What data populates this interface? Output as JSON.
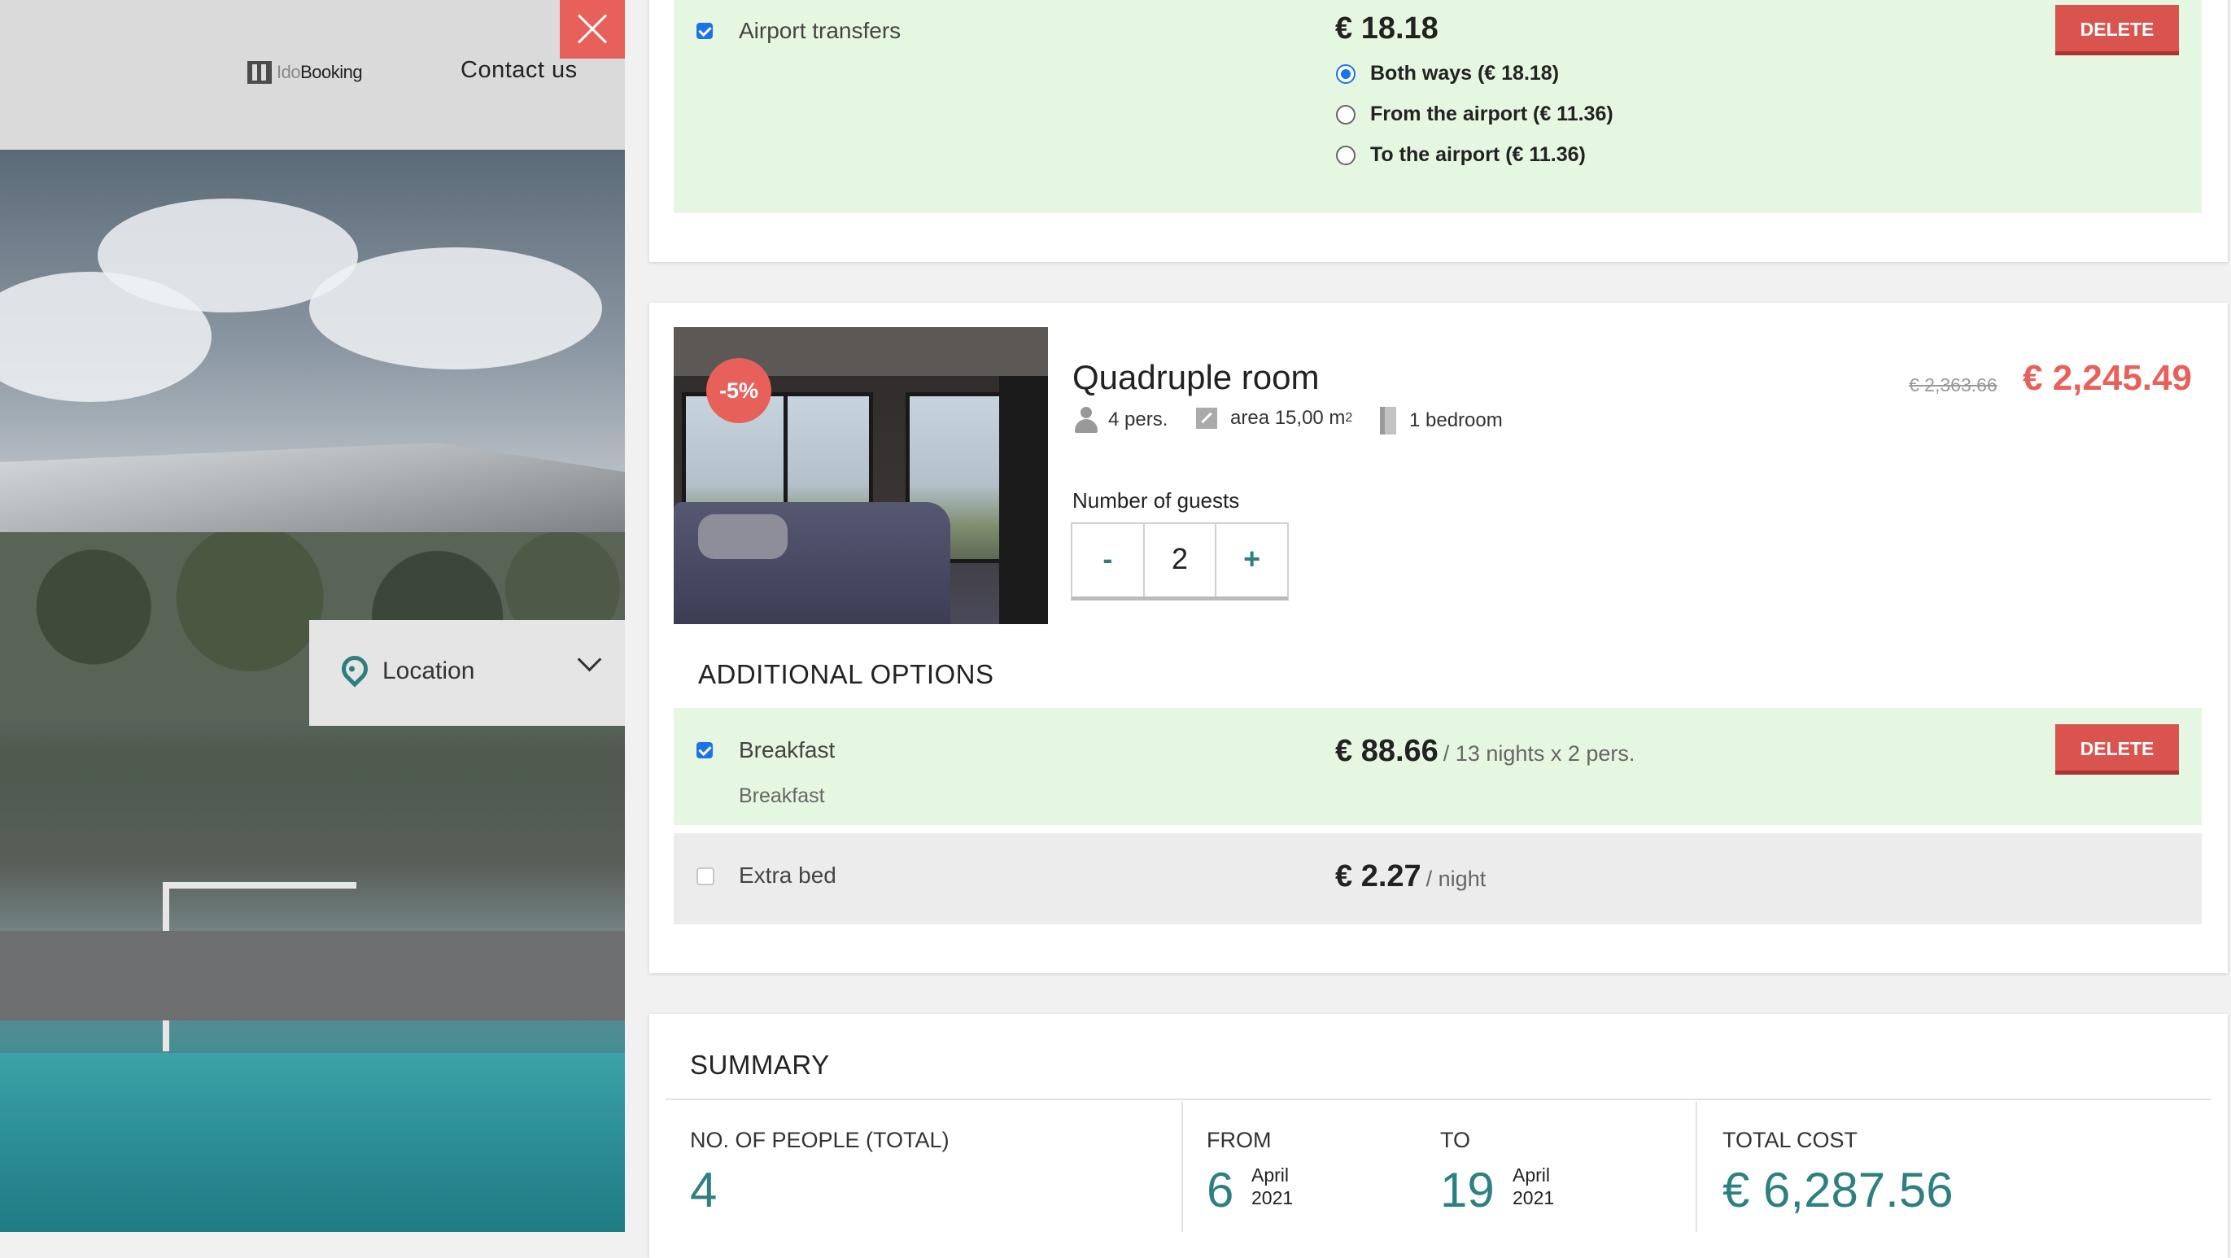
{
  "header": {
    "logo_prefix": "Ido",
    "logo_suffix": "Booking",
    "contact_label": "Contact us"
  },
  "location": {
    "label": "Location"
  },
  "airport": {
    "label": "Airport transfers",
    "checked": true,
    "price": "€ 18.18",
    "delete_label": "DELETE",
    "options": [
      {
        "label": "Both ways (€ 18.18)",
        "selected": true
      },
      {
        "label": "From the airport (€ 11.36)",
        "selected": false
      },
      {
        "label": "To the airport (€ 11.36)",
        "selected": false
      }
    ]
  },
  "room": {
    "discount": "-5%",
    "title": "Quadruple room",
    "persons": "4 pers.",
    "area": "area 15,00 m",
    "area_sup": "2",
    "bedrooms": "1 bedroom",
    "old_price": "€ 2,363.66",
    "new_price": "€ 2,245.49",
    "guests_label": "Number of guests",
    "minus": "-",
    "guests_value": "2",
    "plus": "+"
  },
  "additional": {
    "title": "ADDITIONAL OPTIONS",
    "breakfast": {
      "label": "Breakfast",
      "sublabel": "Breakfast",
      "checked": true,
      "price": "€ 88.66",
      "unit": "/ 13 nights x 2 pers.",
      "delete_label": "DELETE"
    },
    "extra_bed": {
      "label": "Extra bed",
      "checked": false,
      "price": "€ 2.27",
      "unit": "/ night"
    }
  },
  "summary": {
    "title": "SUMMARY",
    "people_label": "NO. OF PEOPLE (TOTAL)",
    "people_value": "4",
    "from_label": "FROM",
    "from_day": "6",
    "from_month": "April",
    "from_year": "2021",
    "to_label": "TO",
    "to_day": "19",
    "to_month": "April",
    "to_year": "2021",
    "total_label": "TOTAL COST",
    "total_value": "€ 6,287.56"
  },
  "colors": {
    "accent_teal": "#2e8080",
    "delete_red": "#d9534f",
    "price_red": "#e8605a",
    "selected_bg": "#e6f7e1"
  }
}
